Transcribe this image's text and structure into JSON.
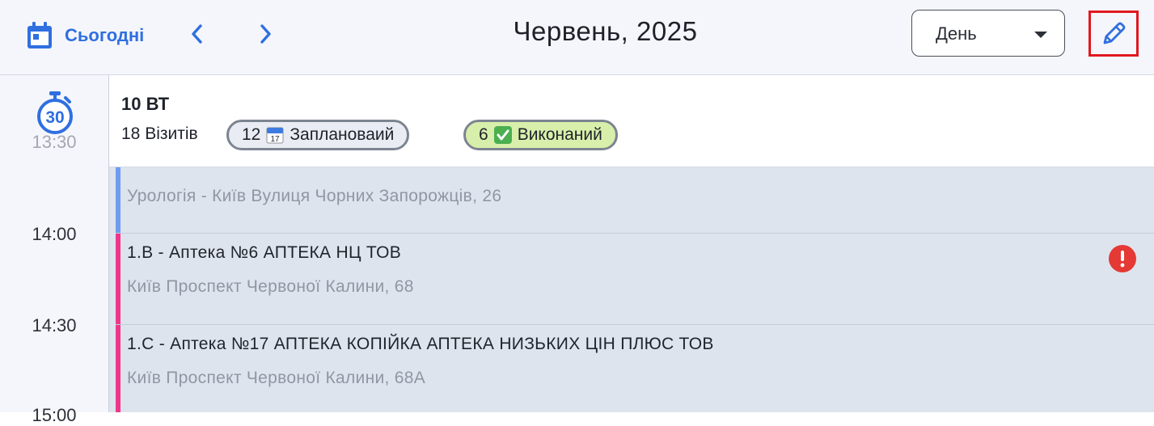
{
  "toolbar": {
    "today_label": "Сьогодні",
    "month_title": "Червень, 2025",
    "view_select": {
      "selected": "День"
    }
  },
  "gutter": {
    "stopwatch_badge": "30",
    "times": [
      "13:30",
      "14:00",
      "14:30",
      "15:00"
    ]
  },
  "day": {
    "title": "10 ВТ",
    "visits": "18 Візитів",
    "planned": {
      "count": "12",
      "label": "Заплановаий",
      "icon": "calendar-emoji-icon"
    },
    "done": {
      "count": "6",
      "label": "Виконаний",
      "icon": "check-emoji-icon"
    }
  },
  "events": [
    {
      "title": "",
      "address": "Урологія - Київ Вулиця Чорних Запорожців, 26",
      "color": "#6f9cf0",
      "alert": false
    },
    {
      "title": "1.B - Аптека №6 АПТЕКА НЦ ТОВ",
      "address": "Київ Проспект Червоної Калини, 68",
      "color": "#f0368a",
      "alert": true
    },
    {
      "title": "1.C - Аптека №17 АПТЕКА КОПІЙКА АПТЕКА НИЗЬКИХ ЦІН ПЛЮС ТОВ",
      "address": "Київ Проспект Червоної Калини, 68А",
      "color": "#f0368a",
      "alert": false
    }
  ],
  "colors": {
    "accent": "#2f6fe0",
    "edit_border": "#e0181e",
    "alert": "#e53935",
    "planned_chip": "#e9ecf2",
    "done_chip": "#d8efab"
  }
}
